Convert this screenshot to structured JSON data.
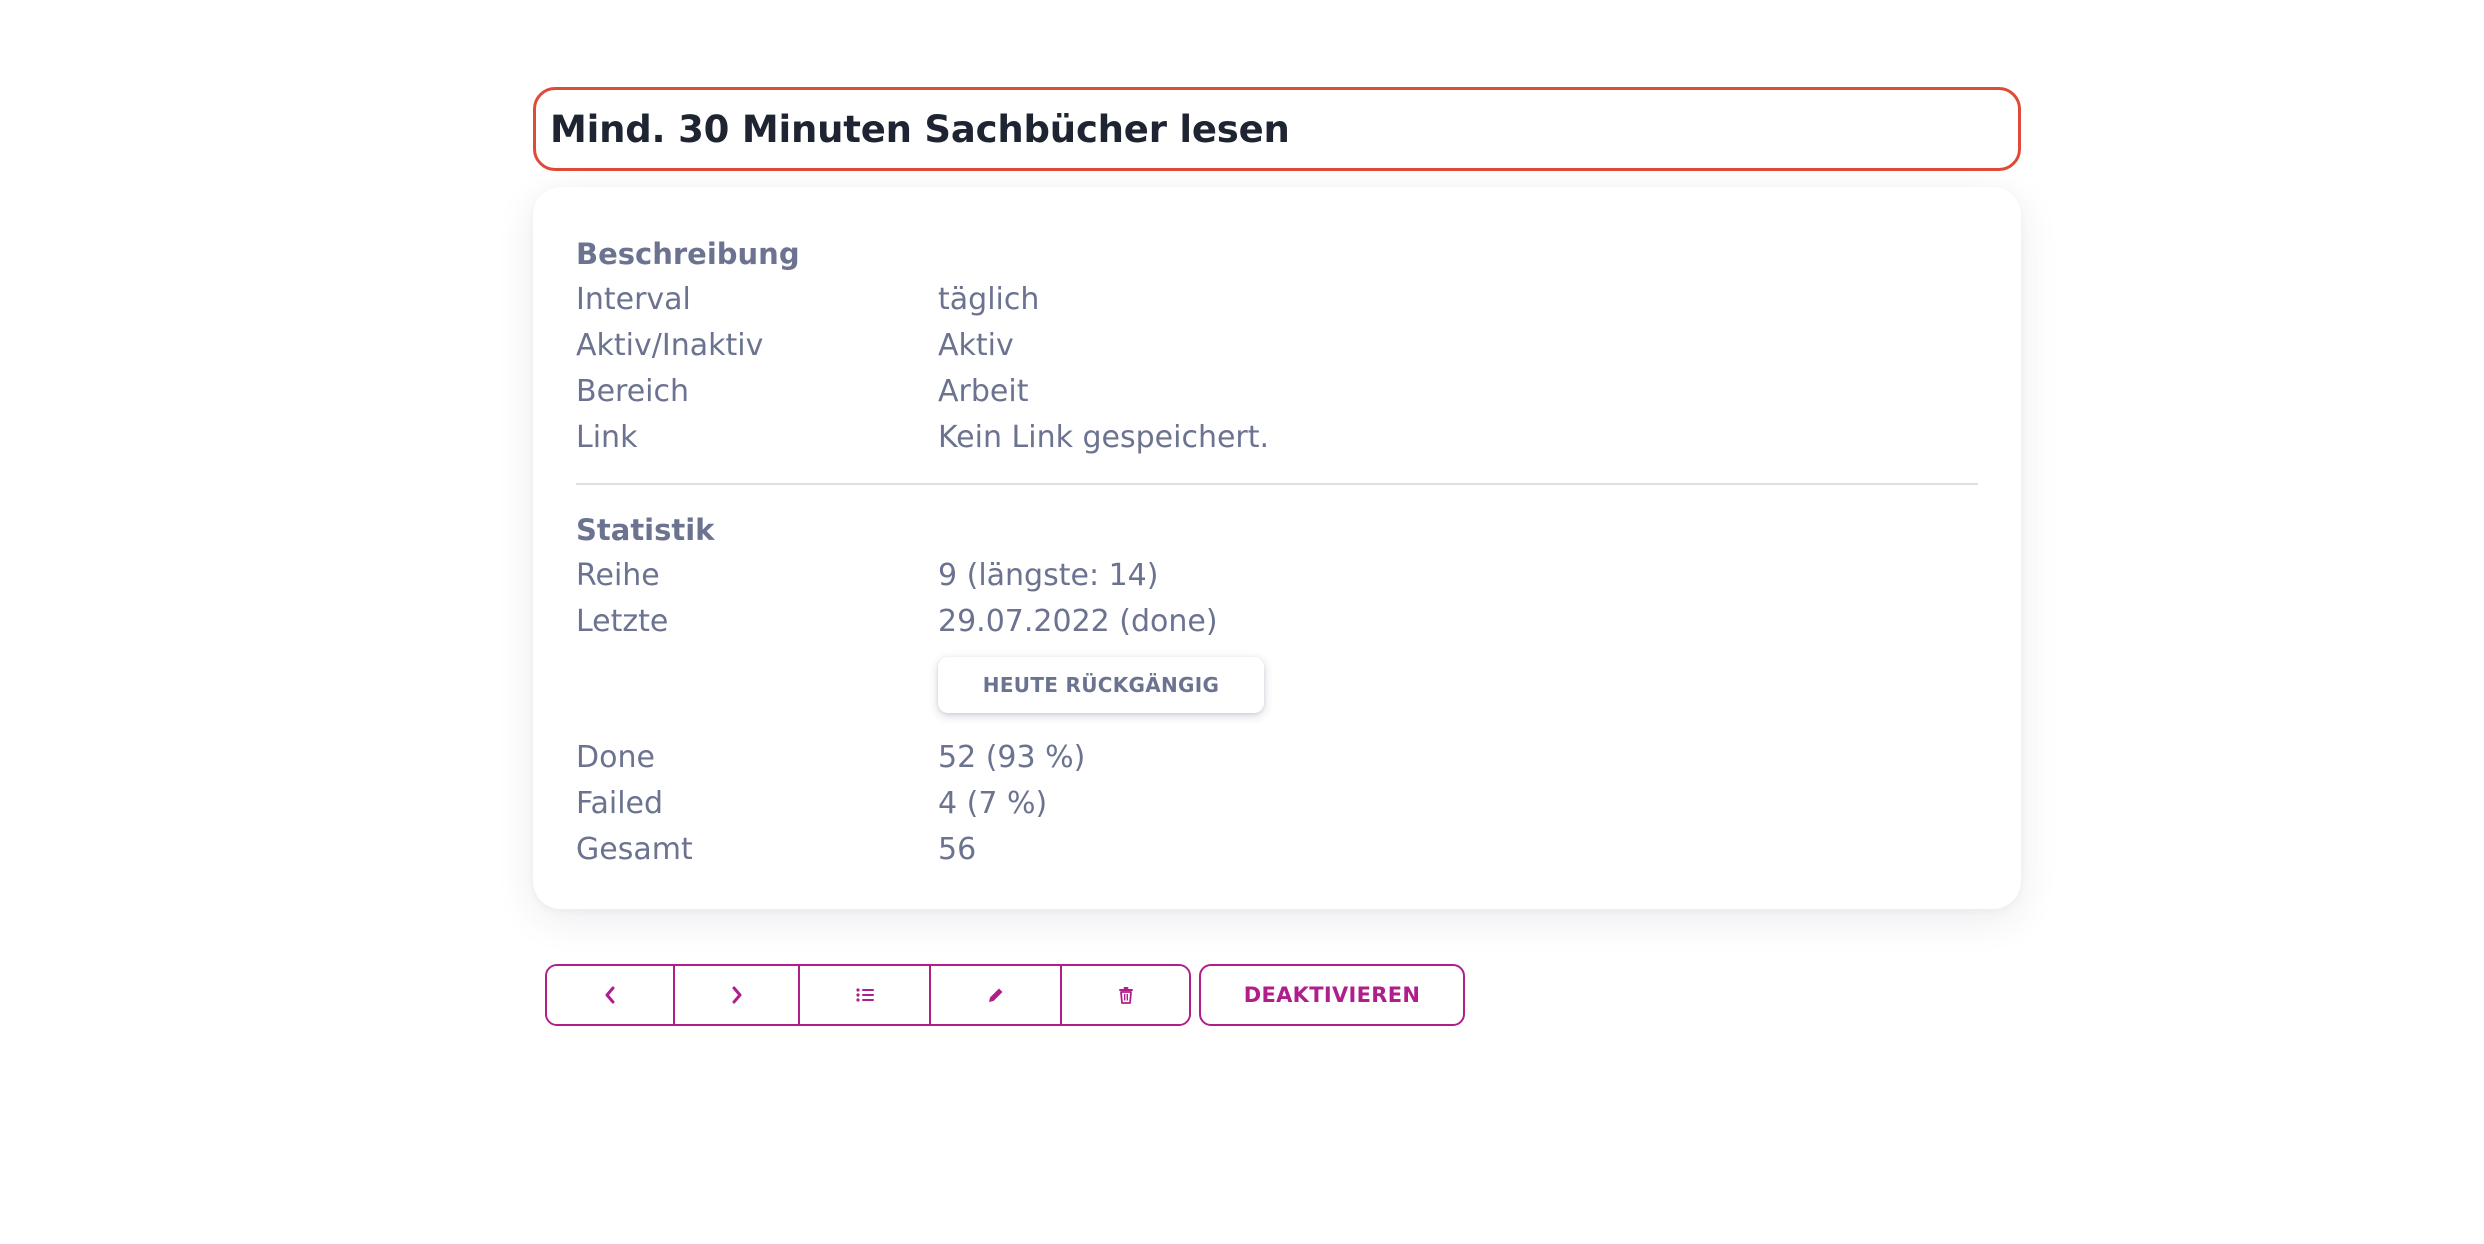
{
  "habit": {
    "title": "Mind. 30 Minuten Sachbücher lesen"
  },
  "description": {
    "heading": "Beschreibung",
    "rows": [
      {
        "label": "Interval",
        "value": "täglich"
      },
      {
        "label": "Aktiv/Inaktiv",
        "value": "Aktiv"
      },
      {
        "label": "Bereich",
        "value": "Arbeit"
      },
      {
        "label": "Link",
        "value": "Kein Link gespeichert."
      }
    ]
  },
  "statistics": {
    "heading": "Statistik",
    "streak": {
      "label": "Reihe",
      "value": "9 (längste: 14)"
    },
    "last": {
      "label": "Letzte",
      "value": "29.07.2022 (done)"
    },
    "undo_label": "HEUTE RÜCKGÄNGIG",
    "done": {
      "label": "Done",
      "value": "52 (93 %)"
    },
    "failed": {
      "label": "Failed",
      "value": "4 (7 %)"
    },
    "total": {
      "label": "Gesamt",
      "value": "56"
    }
  },
  "toolbar": {
    "deactivate_label": "DEAKTIVIEREN",
    "icons": {
      "previous": "chevron-left-icon",
      "next": "chevron-right-icon",
      "list": "list-icon",
      "edit": "pencil-icon",
      "delete": "trash-icon"
    }
  },
  "colors": {
    "accent": "#b01e8c",
    "title_border": "#e04a38",
    "text": "#6b7390",
    "title_text": "#1f2433"
  }
}
